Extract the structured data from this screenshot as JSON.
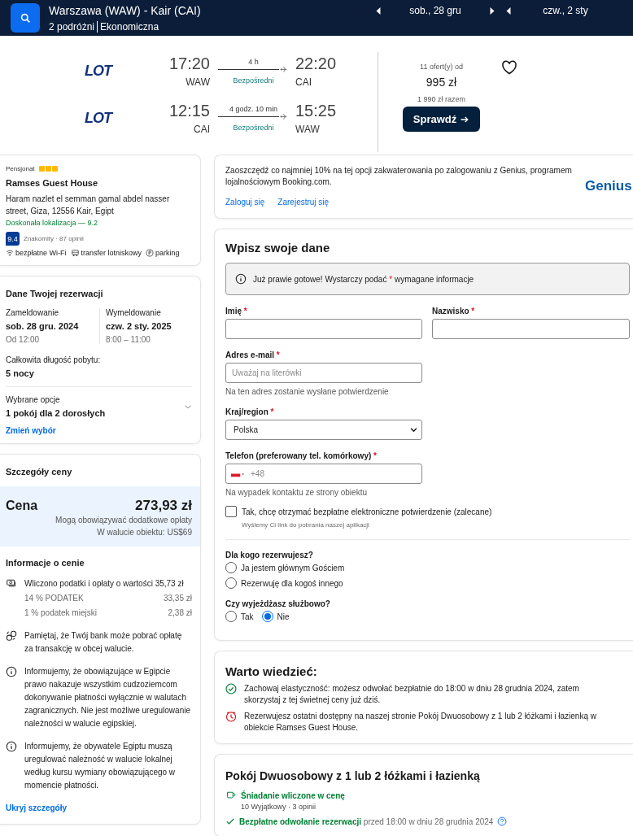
{
  "header": {
    "route": "Warszawa (WAW) - Kair (CAI)",
    "travellers": "2 podróżni",
    "cabin": "Ekonomiczna",
    "dates": [
      {
        "label": "sob., 28 gru",
        "next": true
      },
      {
        "label": "czw., 2 sty",
        "next": false
      }
    ]
  },
  "flight": {
    "legs": [
      {
        "airline": "LOT",
        "depart_time": "17:20",
        "depart_code": "WAW",
        "duration": "4 h",
        "stops": "Bezpośredni",
        "arrive_time": "22:20",
        "arrive_code": "CAI"
      },
      {
        "airline": "LOT",
        "depart_time": "12:15",
        "depart_code": "CAI",
        "duration": "4 godz. 10 min",
        "stops": "Bezpośredni",
        "arrive_time": "15:25",
        "arrive_code": "WAW"
      }
    ],
    "offers": "11 ofert(y) od",
    "price": "995 zł",
    "total": "1 990 zł razem",
    "button": "Sprawdź"
  },
  "hotel": {
    "type": "Pensjonat",
    "stars": 3,
    "name": "Ramses Guest House",
    "address": "Haram nazlet el semman gamal abdel nasser street, Giza, 12556 Kair, Egipt",
    "location": "Doskonała lokalizacja — 9.2",
    "score": "9.4",
    "reviews": "Znakomity · 87 opinii",
    "amenities": [
      {
        "kind": "wifi",
        "label": "bezpłatne Wi-Fi"
      },
      {
        "kind": "shuttle",
        "label": "transfer lotniskowy"
      },
      {
        "kind": "parking",
        "label": "parking"
      }
    ]
  },
  "booking": {
    "title": "Dane Twojej rezerwacji",
    "dates": [
      {
        "label": "Zameldowanie",
        "date": "sob. 28 gru. 2024",
        "time": "Od 12:00"
      },
      {
        "label": "Wymeldowanie",
        "date": "czw. 2 sty. 2025",
        "time": "8:00 – 11:00"
      }
    ],
    "stay_label": "Całkowita długość pobytu:",
    "stay": "5 nocy",
    "options_label": "Wybrane opcje",
    "options": "1 pokój dla 2 dorosłych",
    "change_link": "Zmień wybór"
  },
  "price": {
    "title": "Szczegóły ceny",
    "label": "Cena",
    "amount": "273,93 zł",
    "notes": [
      "Mogą obowiązywać dodatkowe opłaty",
      "W walucie obiektu: US$69"
    ],
    "info_title": "Informacje o cenie",
    "items": [
      {
        "kind": "money",
        "text": "Wliczono podatki i opłaty o wartości 35,73 zł",
        "rows": [
          {
            "label": "14 % PODATEK",
            "value": "33,35 zł"
          },
          {
            "label": "1 % podatek miejski",
            "value": "2,38 zł"
          }
        ]
      },
      {
        "kind": "exchange",
        "text": "Pamiętaj, że Twój bank może pobrać opłatę za transakcję w obcej walucie."
      },
      {
        "kind": "info",
        "text": "Informujemy, że obowiązujące w Egipcie prawo nakazuje wszystkim cudzoziemcom dokonywanie płatności wyłącznie w walutach zagranicznych. Nie jest możliwe uregulowanie należności w walucie egipskiej."
      },
      {
        "kind": "info",
        "text": "Informujemy, że obywatele Egiptu muszą uregulować należność w walucie lokalnej według kursu wymiany obowiązującego w momencie płatności."
      }
    ],
    "toggle": "Ukryj szczegóły"
  },
  "genius": {
    "text": "Zaoszczędź co najmniej 10% na tej opcji zakwaterowania po zalogowaniu z Genius, programem lojalnościowym Booking.com.",
    "login": "Zaloguj się",
    "register": "Zarejestruj się",
    "brand": "Genius"
  },
  "form": {
    "title": "Wpisz swoje dane",
    "notice": {
      "before": "Już prawie gotowe! Wystarczy podać",
      "mark": "*",
      "after": "wymagane informacje"
    },
    "names": [
      {
        "label": "Imię",
        "mark": "*"
      },
      {
        "label": "Nazwisko",
        "mark": "*"
      }
    ],
    "email": {
      "label": "Adres e-mail",
      "mark": "*",
      "placeholder": "Uważaj na literówki",
      "hint": "Na ten adres zostanie wysłane potwierdzenie"
    },
    "country": {
      "label": "Kraj/region",
      "mark": "*",
      "value": "Polska"
    },
    "phone": {
      "label": "Telefon (preferowany tel. komórkowy)",
      "mark": "*",
      "placeholder": "+48",
      "hint": "Na wypadek kontaktu ze strony obiektu"
    },
    "consent": {
      "label": "Tak, chcę otrzymać bezpłatne elektroniczne potwierdzenie (zalecane)",
      "sub": "Wyślemy Ci link do pobrania naszej aplikacji",
      "checked": false
    },
    "groups": [
      {
        "kind": "stacked",
        "question": "Dla kogo rezerwujesz?",
        "options": [
          {
            "label": "Ja jestem głównym Gościem",
            "selected": false
          },
          {
            "label": "Rezerwuję dla kogoś innego",
            "selected": false
          }
        ]
      },
      {
        "kind": "inline",
        "question": "Czy wyjeżdżasz służbowo?",
        "options": [
          {
            "label": "Tak",
            "selected": false
          },
          {
            "label": "Nie",
            "selected": true
          }
        ]
      }
    ]
  },
  "know": {
    "title": "Warto wiedzieć:",
    "items": [
      {
        "kind": "check",
        "text": "Zachowaj elastyczność: możesz odwołać bezpłatnie do 18:00 w dniu 28 grudnia 2024, zatem skorzystaj z tej świetnej ceny już dziś."
      },
      {
        "kind": "clock",
        "text": "Rezerwujesz ostatni dostępny na naszej stronie Pokój Dwuosobowy z 1 lub 2 łóżkami i łazienką w obiekcie Ramses Guest House."
      }
    ]
  },
  "room": {
    "title": "Pokój Dwuosobowy z 1 lub 2 łóżkami i łazienką",
    "features": [
      {
        "kind": "breakfast",
        "title": "Śniadanie wliczone w cenę",
        "sub": "10 Wyjątkowy · 3 opinii"
      },
      {
        "kind": "cancel",
        "title": "Bezpłatne odwołanie rezerwacji",
        "rest": "przed 18:00 w dniu 28 grudnia 2024"
      }
    ]
  }
}
